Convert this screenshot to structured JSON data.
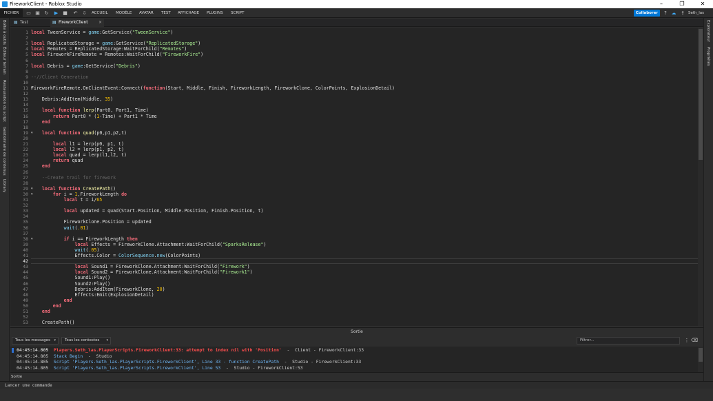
{
  "window": {
    "title": "FireworkClient - Roblox Studio",
    "controls": [
      "–",
      "❐",
      "✕"
    ]
  },
  "ribbon": {
    "file_label": "FICHIER",
    "tabs": [
      "ACCUEIL",
      "MODÈLE",
      "AVATAR",
      "TEST",
      "AFFICHAGE",
      "PLUGINS",
      "SCRIPT"
    ],
    "collaborate_label": "Collaborer",
    "user_name": "Seth_las"
  },
  "left_panels": [
    "Boîte à outils",
    "Éditeur terrain",
    "Restauration du script",
    "Gestionnaire de contenus",
    "Library"
  ],
  "right_panels": [
    "Explorateur",
    "Propriétés"
  ],
  "doc_tabs": [
    {
      "label": "Test",
      "active": false
    },
    {
      "label": "FireworkClient",
      "active": true
    }
  ],
  "editor": {
    "current_line": 42,
    "lines": [
      {
        "n": "1",
        "html": "<span class='kw'>local</span> TweenService = <span class='bi'>game</span>:GetService(<span class='str'>\"TweenService\"</span>)"
      },
      {
        "n": "2",
        "html": ""
      },
      {
        "n": "3",
        "html": "<span class='kw'>local</span> ReplicatedStorage = <span class='bi'>game</span>:GetService(<span class='str'>\"ReplicatedStorage\"</span>)"
      },
      {
        "n": "4",
        "html": "<span class='kw'>local</span> Remotes = ReplicatedStorage:WaitForChild(<span class='str'>\"Remotes\"</span>)"
      },
      {
        "n": "5",
        "html": "<span class='kw'>local</span> FireworkFireRemote = Remotes:WaitForChild(<span class='str'>\"FireworkFire\"</span>)"
      },
      {
        "n": "6",
        "html": ""
      },
      {
        "n": "7",
        "html": "<span class='kw'>local</span> Debris = <span class='bi'>game</span>:GetService(<span class='str'>\"Debris\"</span>)"
      },
      {
        "n": "8",
        "html": ""
      },
      {
        "n": "9",
        "html": "<span class='cm'>--//Client Generation</span>"
      },
      {
        "n": "10",
        "html": ""
      },
      {
        "n": "11",
        "html": "FireworkFireRemote.OnClientEvent:Connect(<span class='kw'>function</span>(Start, Middle, Finish, FireworkLength, FireworkClone, ColorPoints, ExplosionDetail)"
      },
      {
        "n": "12",
        "html": ""
      },
      {
        "n": "13",
        "html": "    Debris:AddItem(Middle, <span class='num'>35</span>)"
      },
      {
        "n": "14",
        "html": ""
      },
      {
        "n": "15",
        "html": "    <span class='kw'>local</span> <span class='kw'>function</span> <span class='fn'>lerp</span>(Part0, Part1, Time)"
      },
      {
        "n": "16",
        "html": "        <span class='kw'>return</span> Part0 * (<span class='num'>1</span>-Time) + Part1 * Time"
      },
      {
        "n": "17",
        "html": "    <span class='kw'>end</span>"
      },
      {
        "n": "18",
        "html": ""
      },
      {
        "n": "19",
        "html": "    <span class='kw'>local</span> <span class='kw'>function</span> <span class='fn'>quad</span>(p0,p1,p2,t)"
      },
      {
        "n": "20",
        "html": ""
      },
      {
        "n": "21",
        "html": "        <span class='kw'>local</span> l1 = lerp(p0, p1, t)"
      },
      {
        "n": "22",
        "html": "        <span class='kw'>local</span> l2 = lerp(p1, p2, t)"
      },
      {
        "n": "23",
        "html": "        <span class='kw'>local</span> quad = lerp(l1,l2, t)"
      },
      {
        "n": "24",
        "html": "        <span class='kw'>return</span> quad"
      },
      {
        "n": "25",
        "html": "    <span class='kw'>end</span>"
      },
      {
        "n": "26",
        "html": ""
      },
      {
        "n": "27",
        "html": "    <span class='cm'>--Create trail for firework</span>"
      },
      {
        "n": "28",
        "html": ""
      },
      {
        "n": "29",
        "html": "    <span class='kw'>local</span> <span class='kw'>function</span> <span class='fn'>CreatePath</span>()"
      },
      {
        "n": "30",
        "html": "        <span class='kw'>for</span> i = <span class='num'>1</span>,FireworkLength <span class='kw'>do</span>"
      },
      {
        "n": "31",
        "html": "            <span class='kw'>local</span> t = i/<span class='num'>65</span>"
      },
      {
        "n": "32",
        "html": ""
      },
      {
        "n": "33",
        "html": "            <span class='kw'>local</span> updated = quad(Start.Position, Middle.Position, Finish.Position, t)"
      },
      {
        "n": "34",
        "html": ""
      },
      {
        "n": "35",
        "html": "            FireworkClone.Position = updated"
      },
      {
        "n": "36",
        "html": "            <span class='bi'>wait</span>(<span class='num'>.01</span>)"
      },
      {
        "n": "37",
        "html": ""
      },
      {
        "n": "38",
        "html": "            <span class='kw'>if</span> i == FireworkLength <span class='kw'>then</span>"
      },
      {
        "n": "39",
        "html": "                <span class='kw'>local</span> Effects = FireworkClone.Attachment:WaitForChild(<span class='str'>\"SparksRelease\"</span>)"
      },
      {
        "n": "40",
        "html": "                <span class='bi'>wait</span>(<span class='num'>.05</span>)"
      },
      {
        "n": "41",
        "html": "                Effects.Color = <span class='bi'>ColorSequence</span>.<span class='bi'>new</span>(ColorPoints)"
      },
      {
        "n": "42",
        "html": ""
      },
      {
        "n": "43",
        "html": "                <span class='kw'>local</span> Sound1 = FireworkClone.Attachment:WaitForChild(<span class='str'>\"Firework\"</span>)"
      },
      {
        "n": "44",
        "html": "                <span class='kw'>local</span> Sound2 = FireworkClone.Attachment:WaitForChild(<span class='str'>\"Firework1\"</span>)"
      },
      {
        "n": "45",
        "html": "                Sound1:Play()"
      },
      {
        "n": "46",
        "html": "                Sound2:Play()"
      },
      {
        "n": "47",
        "html": "                Debris:AddItem(FireworkClone, <span class='num'>20</span>)"
      },
      {
        "n": "48",
        "html": "                Effects:Emit(ExplosionDetail)"
      },
      {
        "n": "49",
        "html": "            <span class='kw'>end</span>"
      },
      {
        "n": "50",
        "html": "        <span class='kw'>end</span>"
      },
      {
        "n": "51",
        "html": "    <span class='kw'>end</span>"
      },
      {
        "n": "52",
        "html": ""
      },
      {
        "n": "53",
        "html": "    CreatePath()"
      }
    ],
    "fold_lines": [
      "11",
      "19",
      "29",
      "30",
      "38"
    ]
  },
  "output": {
    "title": "Sortie",
    "message_filter": "Tous les messages",
    "context_filter": "Tous les contextes",
    "filter_placeholder": "Filtrer...",
    "footer_label": "Sortie",
    "lines": [
      {
        "type": "err",
        "time": "04:45:14.805",
        "text": "Players.Seth_las.PlayerScripts.FireworkClient:33: attempt to index nil with 'Position'",
        "rest": "  -  Client - FireworkClient:33"
      },
      {
        "type": "info",
        "time": "04:45:14.805",
        "text": "Stack Begin",
        "rest": "  -  Studio"
      },
      {
        "type": "info",
        "time": "04:45:14.805",
        "text": "Script 'Players.Seth_las.PlayerScripts.FireworkClient', Line 33 - function CreatePath",
        "rest": "  -  Studio - FireworkClient:33"
      },
      {
        "type": "info",
        "time": "04:45:14.805",
        "text": "Script 'Players.Seth_las.PlayerScripts.FireworkClient', Line 53",
        "rest": "  -  Studio - FireworkClient:53"
      }
    ]
  },
  "command_bar": {
    "placeholder": "Lancer une commande"
  }
}
